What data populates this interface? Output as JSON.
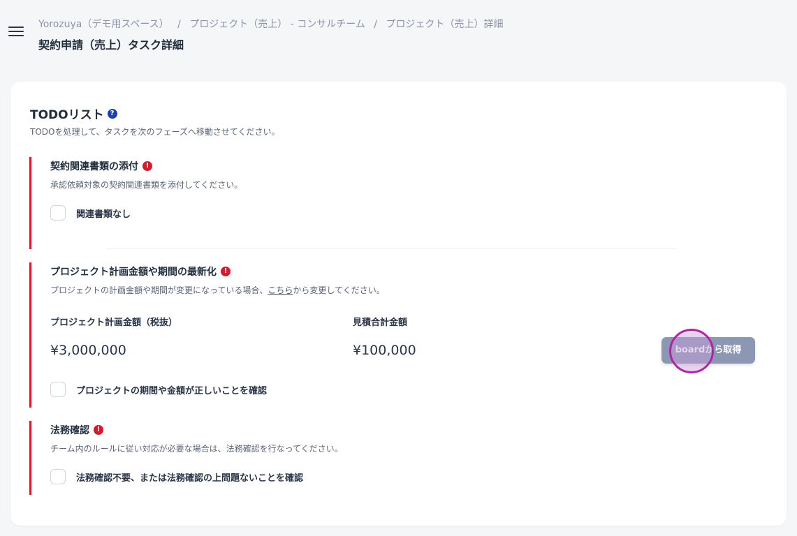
{
  "header": {
    "breadcrumb": [
      "Yorozuya（デモ用スペース）",
      "プロジェクト（売上） - コンサルチーム",
      "プロジェクト（売上）詳細"
    ],
    "separator": "/",
    "title": "契約申請（売上）タスク詳細"
  },
  "todo": {
    "title": "TODOリスト",
    "help_icon": "?",
    "description": "TODOを処理して、タスクを次のフェーズへ移動させてください。"
  },
  "sections": [
    {
      "title": "契約関連書類の添付",
      "description": "承認依頼対象の契約関連書類を添付してください。",
      "checkbox_label": "関連書類なし"
    },
    {
      "title": "プロジェクト計画金額や期間の最新化",
      "description_before": "プロジェクトの計画金額や期間が変更になっている場合、",
      "description_link": "こちら",
      "description_after": "から変更してください。",
      "planned_amount_label": "プロジェクト計画金額（税抜）",
      "planned_amount_value": "¥3,000,000",
      "estimate_total_label": "見積合計金額",
      "estimate_total_value": "¥100,000",
      "board_button_label": "boardから取得",
      "checkbox_label": "プロジェクトの期間や金額が正しいことを確認"
    },
    {
      "title": "法務確認",
      "description": "チーム内のルールに従い対応が必要な場合は、法務確認を行なってください。",
      "checkbox_label": "法務確認不要、または法務確認の上問題ないことを確認"
    }
  ],
  "warn_icon": "!",
  "colors": {
    "accent_required": "#d7192b",
    "help_icon": "#1b3fb5",
    "button_bg": "#8c97b4",
    "click_marker": "#b224a5"
  },
  "icons": {
    "menu": "hamburger-menu-icon",
    "help": "help-icon",
    "warning": "warning-icon"
  }
}
